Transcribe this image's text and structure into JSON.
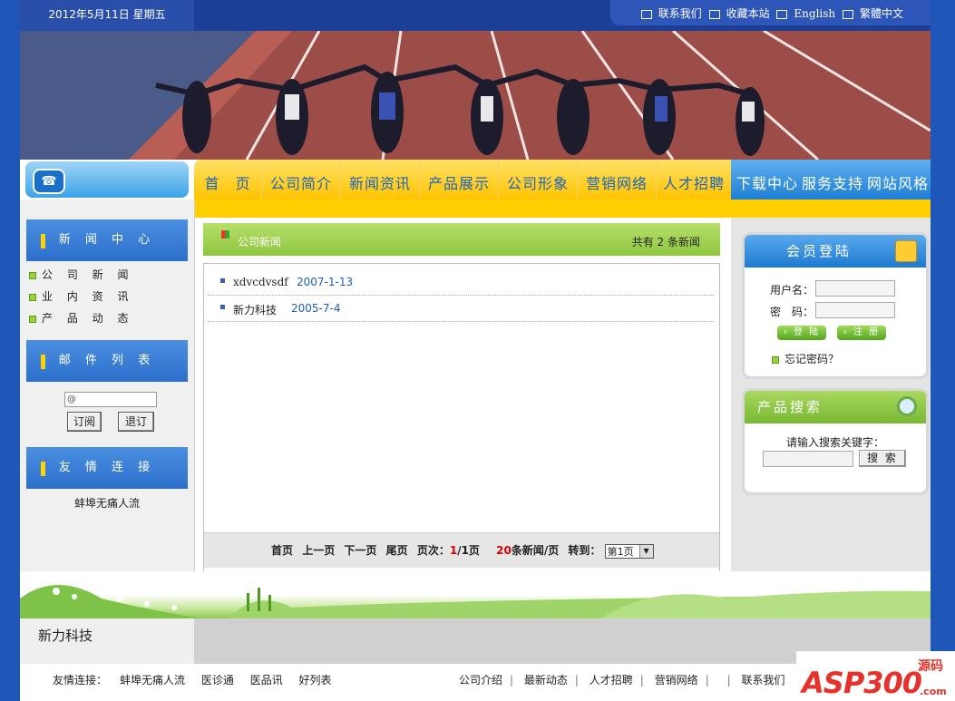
{
  "header": {
    "date": "2012年5月11日 星期五",
    "links": [
      {
        "label": "联系我们",
        "icon": "mail-icon"
      },
      {
        "label": "收藏本站",
        "icon": "favorite-icon"
      },
      {
        "label": "English",
        "icon": "home-icon"
      },
      {
        "label": "繁體中文",
        "icon": "home-icon"
      }
    ]
  },
  "nav": {
    "yellow": [
      "首　页",
      "公司简介",
      "新闻资讯",
      "产品展示",
      "公司形象",
      "营销网络",
      "人才招聘"
    ],
    "blue": [
      "下载中心",
      "服务支持",
      "网站风格"
    ]
  },
  "left": {
    "news_center": "新 闻 中 心",
    "news_items": [
      "公 司 新 闻",
      "业 内 资 讯",
      "产 品 动 态"
    ],
    "mail_list": "邮 件 列 表",
    "mail_placeholder": "@",
    "subscribe": "订阅",
    "unsubscribe": "退订",
    "links_title": "友 情 连 接",
    "friend_link": "蚌埠无痛人流",
    "brand": "新力科技"
  },
  "center": {
    "title": "公司新闻",
    "count_text": "共有 2 条新闻",
    "news": [
      {
        "title": "xdvcdvsdf",
        "date": "2007-1-13"
      },
      {
        "title": "新力科技",
        "date": "2005-7-4"
      }
    ],
    "pager": {
      "first": "首页",
      "prev": "上一页",
      "next": "下一页",
      "last": "尾页",
      "page_label": "页次：",
      "current": "1",
      "total": "/1页",
      "per_page_num": "20",
      "per_page_text": "条新闻/页",
      "goto": "转到：",
      "select_value": "第1页"
    }
  },
  "right": {
    "login_title": "会员登陆",
    "username_label": "用户名：",
    "password_label": "密　码：",
    "login_btn": "登 陆",
    "register_btn": "注 册",
    "forgot": "忘记密码？",
    "search_title": "产品搜索",
    "search_prompt": "请输入搜索关键字：",
    "search_btn": "搜 索"
  },
  "footer": {
    "friend_links_label": "友情连接：",
    "friend_links": [
      "蚌埠无痛人流",
      "医诊通",
      "医品讯",
      "好列表"
    ],
    "links": [
      "公司介绍",
      "最新动态",
      "人才招聘",
      "营销网络",
      "",
      "联系我们"
    ],
    "logo_text": "ASP300",
    "logo_sub": "源码",
    "logo_domain": ".com"
  },
  "colors": {
    "body_bg": "#1f57b9",
    "nav_yellow": "#ffc400",
    "nav_blue": "#1e7ed4",
    "green_header": "#8ec63f",
    "date_red": "#d00000"
  }
}
